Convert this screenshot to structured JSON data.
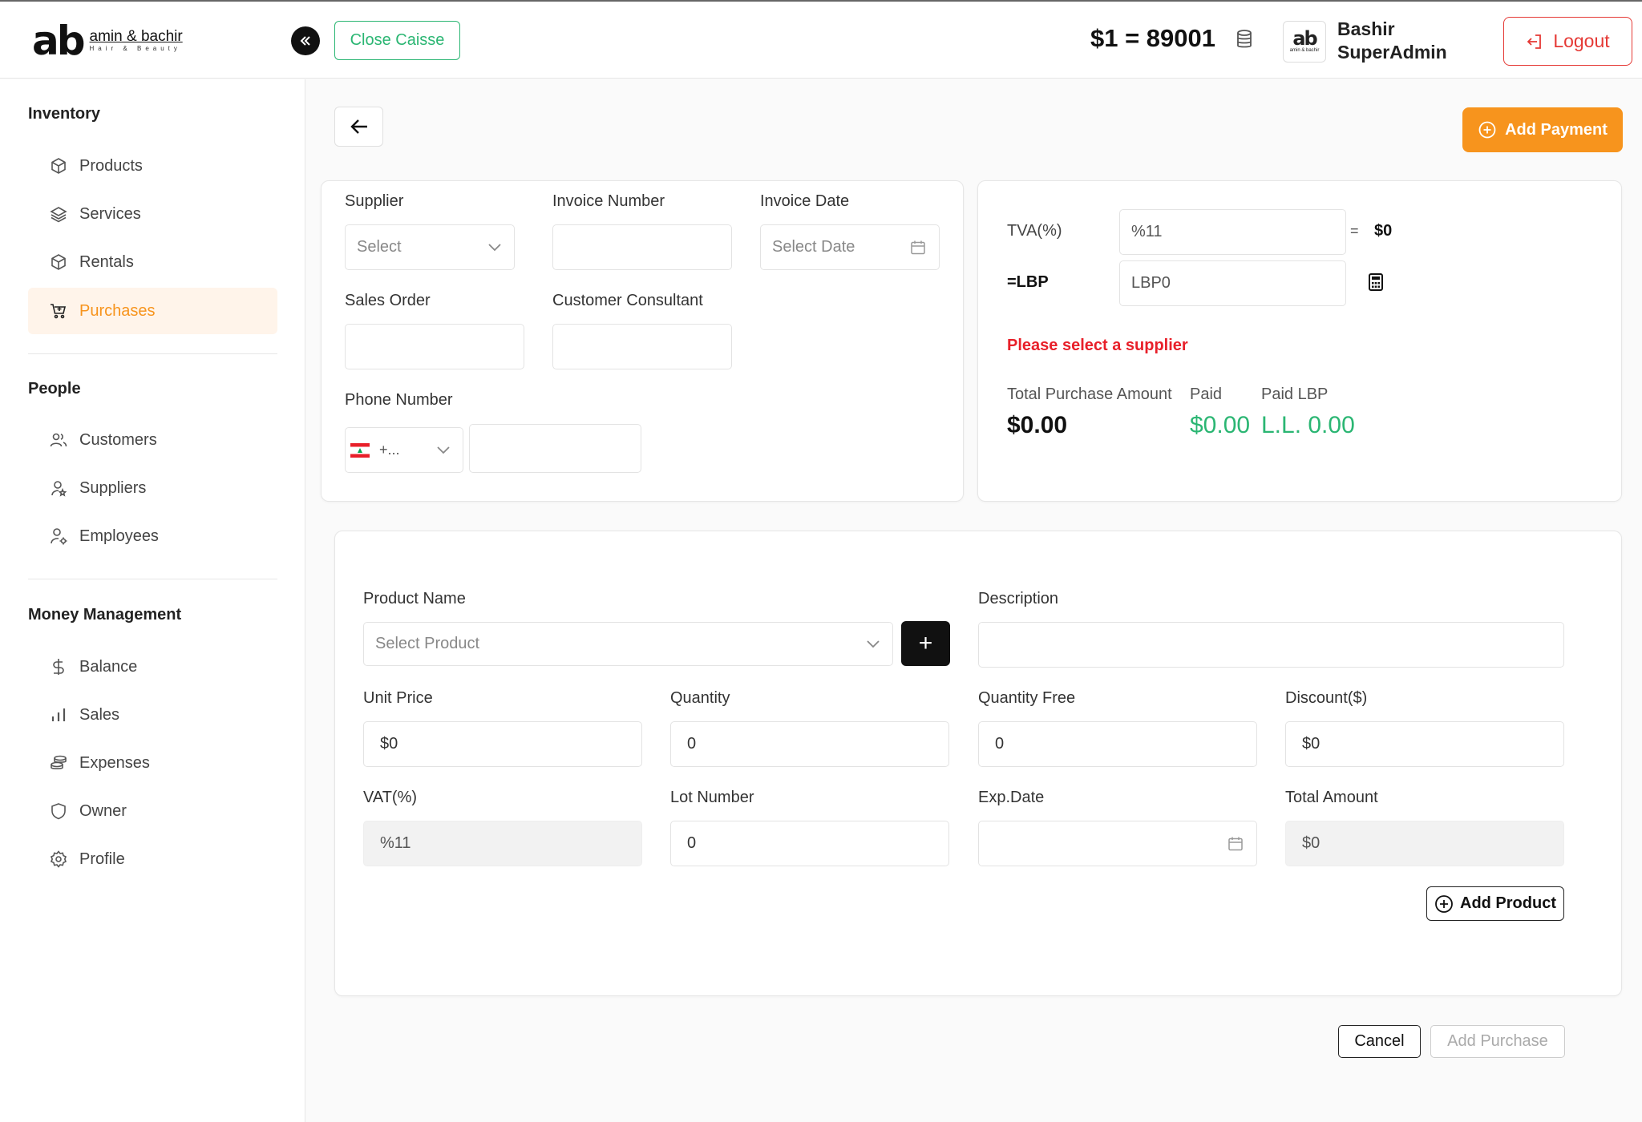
{
  "header": {
    "logo_mark": "ab",
    "logo_name": "amin & bachir",
    "logo_sub": "Hair & Beauty",
    "close_caisse": "Close Caisse",
    "rate": "$1 = 89001",
    "avatar_mark": "ab",
    "avatar_sub": "amin & bachir",
    "user_first": "Bashir",
    "user_role": "SuperAdmin",
    "logout": "Logout"
  },
  "sidebar": {
    "sections": [
      {
        "title": "Inventory",
        "items": [
          {
            "label": "Products",
            "icon": "box-icon"
          },
          {
            "label": "Services",
            "icon": "layers-icon"
          },
          {
            "label": "Rentals",
            "icon": "box-icon"
          },
          {
            "label": "Purchases",
            "icon": "cart-icon",
            "active": true
          }
        ]
      },
      {
        "title": "People",
        "items": [
          {
            "label": "Customers",
            "icon": "users-icon"
          },
          {
            "label": "Suppliers",
            "icon": "user-star-icon"
          },
          {
            "label": "Employees",
            "icon": "user-gear-icon"
          }
        ]
      },
      {
        "title": "Money Management",
        "items": [
          {
            "label": "Balance",
            "icon": "dollar-icon"
          },
          {
            "label": "Sales",
            "icon": "bar-chart-icon"
          },
          {
            "label": "Expenses",
            "icon": "coins-icon"
          },
          {
            "label": "Owner",
            "icon": "shield-icon"
          },
          {
            "label": "Profile",
            "icon": "gear-icon"
          }
        ]
      }
    ]
  },
  "toolbar": {
    "add_payment": "Add Payment"
  },
  "invoice": {
    "supplier_label": "Supplier",
    "supplier_value": "Select",
    "invoice_number_label": "Invoice Number",
    "invoice_number_value": "",
    "invoice_date_label": "Invoice Date",
    "invoice_date_placeholder": "Select Date",
    "sales_order_label": "Sales Order",
    "sales_order_value": "",
    "consultant_label": "Customer Consultant",
    "consultant_value": "",
    "phone_label": "Phone Number",
    "phone_code": "+...",
    "phone_value": ""
  },
  "summary": {
    "tva_label": "TVA(%)",
    "tva_value": "%11",
    "equals": "=",
    "tva_result": "$0",
    "lbp_label": "=LBP",
    "lbp_value": "LBP0",
    "error": "Please select a supplier",
    "total_label": "Total Purchase Amount",
    "total_value": "$0.00",
    "paid_label": "Paid",
    "paid_value": "$0.00",
    "paid_lbp_label": "Paid LBP",
    "paid_lbp_value": "L.L. 0.00",
    "green": "#2bb673",
    "red": "#e8202a"
  },
  "product": {
    "name_label": "Product Name",
    "name_placeholder": "Select Product",
    "plus": "+",
    "description_label": "Description",
    "description_value": "",
    "unit_price_label": "Unit Price",
    "unit_price_value": "$0",
    "quantity_label": "Quantity",
    "quantity_value": "0",
    "quantity_free_label": "Quantity Free",
    "quantity_free_value": "0",
    "discount_label": "Discount($)",
    "discount_value": "$0",
    "vat_label": "VAT(%)",
    "vat_value": "%11",
    "lot_label": "Lot Number",
    "lot_value": "0",
    "exp_label": "Exp.Date",
    "exp_value": "",
    "total_label": "Total Amount",
    "total_value": "$0",
    "add_product": "Add Product"
  },
  "footer": {
    "cancel": "Cancel",
    "add_purchase": "Add Purchase"
  },
  "colors": {
    "accent": "#f7941d",
    "active_bg": "#fff4ea"
  }
}
